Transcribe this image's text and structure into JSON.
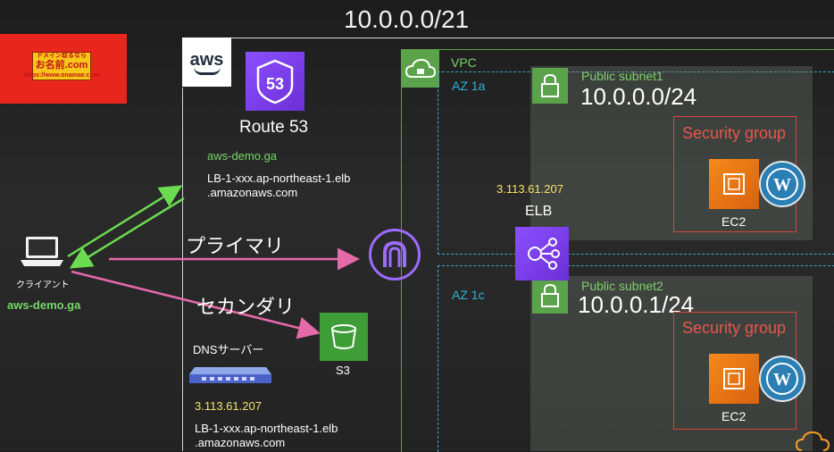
{
  "top_cidr": "10.0.0.0/21",
  "onamae": {
    "line1": "ドメイン取るなら",
    "brand": "お名前.com",
    "url": "https://www.onamae.com"
  },
  "aws": {
    "logo_text": "aws"
  },
  "route53": {
    "icon_text": "53",
    "label": "Route 53",
    "domain": "aws-demo.ga",
    "target_line1": "LB-1-xxx.ap-northeast-1.elb",
    "target_line2": ".amazonaws.com"
  },
  "client": {
    "label": "クライアント",
    "domain": "aws-demo.ga"
  },
  "primary_label": "プライマリ",
  "secondary_label": "セカンダリ",
  "s3": {
    "label": "S3"
  },
  "dns_server": {
    "label": "DNSサーバー",
    "ip": "3.113.61.207",
    "target_line1": "LB-1-xxx.ap-northeast-1.elb",
    "target_line2": ".amazonaws.com"
  },
  "vpc": {
    "label": "VPC"
  },
  "az1": {
    "label": "AZ 1a"
  },
  "az2": {
    "label": "AZ 1c"
  },
  "elb": {
    "label": "ELB",
    "ip": "3.113.61.207"
  },
  "subnet1": {
    "title": "Public subnet1",
    "cidr": "10.0.0.0/24",
    "sg_label": "Security group",
    "ec2_label": "EC2"
  },
  "subnet2": {
    "title": "Public subnet2",
    "cidr": "10.0.0.1/24",
    "sg_label": "Security group",
    "ec2_label": "EC2"
  },
  "colors": {
    "green_arrow": "#6bdc4f",
    "pink_arrow": "#e56aa8",
    "vpc_green": "#5aa34a",
    "az_blue": "#2fb0d8",
    "sg_red": "#d9433a"
  }
}
